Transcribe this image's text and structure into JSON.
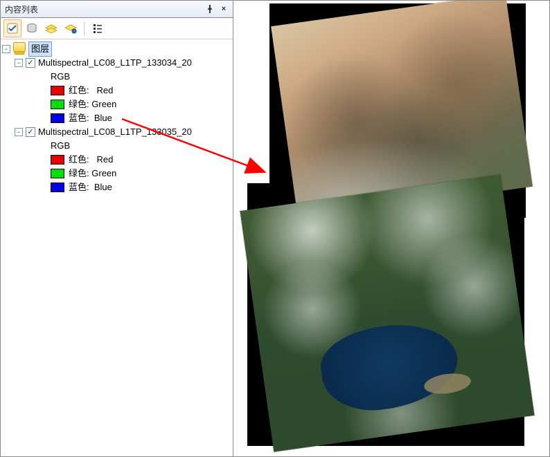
{
  "panel": {
    "title": "内容列表",
    "pin_tooltip": "自动隐藏",
    "close_tooltip": "关闭"
  },
  "toolbar": {
    "buttons": [
      "按绘制顺序",
      "按源",
      "按可见性",
      "按选择"
    ],
    "options": "选项"
  },
  "tree": {
    "root_label": "图层",
    "layers": [
      {
        "name": "Multispectral_LC08_L1TP_133034_20",
        "checked": true,
        "renderer_label": "RGB",
        "bands": [
          {
            "label": "红色:",
            "value": "Red",
            "color": "red"
          },
          {
            "label": "绿色:",
            "value": "Green",
            "color": "green"
          },
          {
            "label": "蓝色:",
            "value": "Blue",
            "color": "blue"
          }
        ]
      },
      {
        "name": "Multispectral_LC08_L1TP_133035_20",
        "checked": true,
        "renderer_label": "RGB",
        "bands": [
          {
            "label": "红色:",
            "value": "Red",
            "color": "red"
          },
          {
            "label": "绿色:",
            "value": "Green",
            "color": "green"
          },
          {
            "label": "蓝色:",
            "value": "Blue",
            "color": "blue"
          }
        ]
      }
    ]
  },
  "glyphs": {
    "minus": "−",
    "plus": "+",
    "pin": "📌",
    "close": "×"
  }
}
